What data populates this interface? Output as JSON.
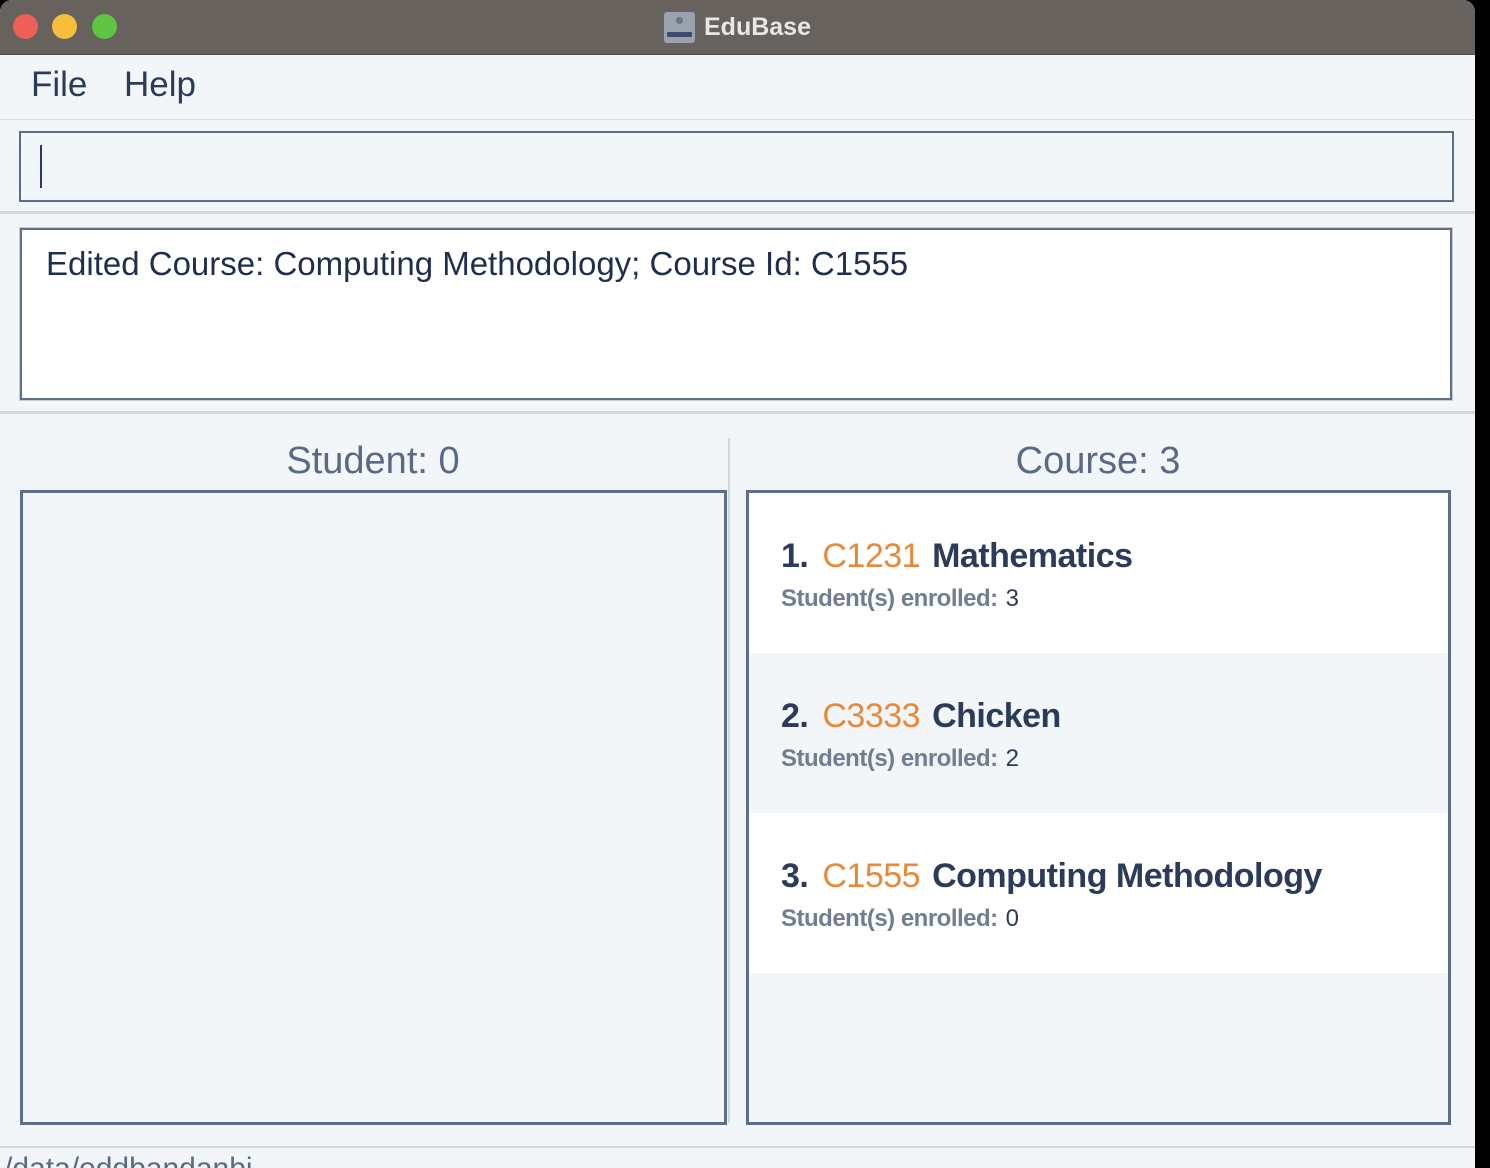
{
  "window": {
    "title": "EduBase"
  },
  "menu": {
    "file": "File",
    "help": "Help"
  },
  "command": {
    "value": ""
  },
  "result": {
    "message": "Edited Course: Computing Methodology; Course Id: C1555"
  },
  "student_panel": {
    "header": "Student: 0",
    "items": []
  },
  "course_panel": {
    "header": "Course: 3",
    "items": [
      {
        "index": "1.",
        "id": "C1231",
        "name": "Mathematics",
        "enrolled_label": "Student(s) enrolled:",
        "enrolled": "3"
      },
      {
        "index": "2.",
        "id": "C3333",
        "name": "Chicken",
        "enrolled_label": "Student(s) enrolled:",
        "enrolled": "2"
      },
      {
        "index": "3.",
        "id": "C1555",
        "name": "Computing Methodology",
        "enrolled_label": "Student(s) enrolled:",
        "enrolled": "0"
      }
    ]
  },
  "status_bar": {
    "path": "/data/eddbandanbi..."
  },
  "colors": {
    "accent_course_id": "#e8893a",
    "text_primary": "#2c3b59",
    "border": "#5d6d8a",
    "titlebar": "#67625e"
  }
}
